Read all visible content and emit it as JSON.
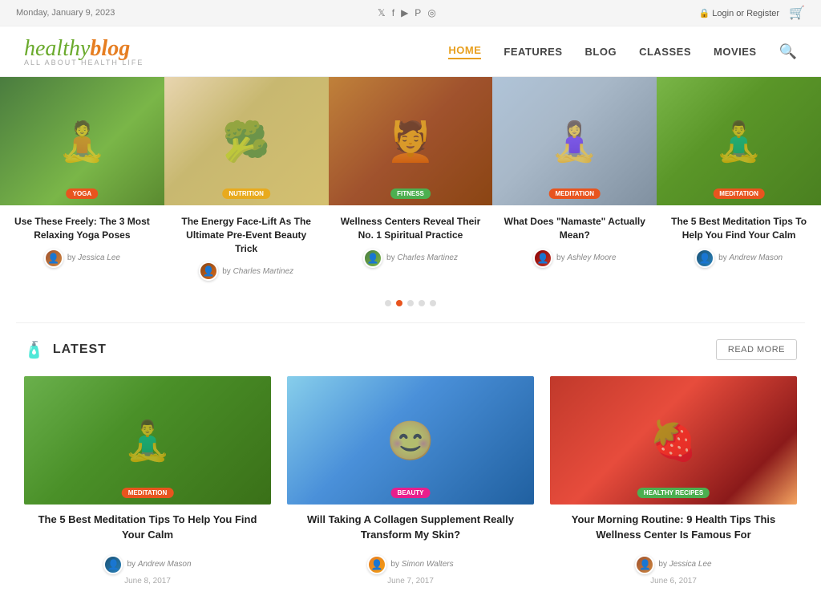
{
  "topBar": {
    "date": "Monday, January 9, 2023",
    "social": [
      "twitter",
      "facebook",
      "youtube",
      "pinterest",
      "instagram"
    ],
    "login": "Login",
    "or": "or",
    "register": "Register"
  },
  "header": {
    "logo": {
      "healthy": "healthy",
      "blog": "blog",
      "sub": "ALL ABOUT HEALTH LIFE"
    },
    "nav": [
      {
        "label": "HOME",
        "active": true
      },
      {
        "label": "FEATURES",
        "active": false
      },
      {
        "label": "BLOG",
        "active": false
      },
      {
        "label": "CLASSES",
        "active": false
      },
      {
        "label": "MOVIES",
        "active": false
      }
    ]
  },
  "carousel": {
    "items": [
      {
        "category": "YOGA",
        "categoryColor": "yoga",
        "title": "Use These Freely: The 3 Most Relaxing Yoga Poses",
        "author": "Jessica Lee",
        "avatarClass": "avatar-jessica"
      },
      {
        "category": "NUTRITION",
        "categoryColor": "nutrition",
        "title": "The Energy Face-Lift As The Ultimate Pre-Event Beauty Trick",
        "author": "Charles Martinez",
        "avatarClass": "avatar-charles"
      },
      {
        "category": "FITNESS",
        "categoryColor": "fitness",
        "title": "Wellness Centers Reveal Their No. 1 Spiritual Practice",
        "author": "Charles Martinez",
        "avatarClass": "avatar-charlesm"
      },
      {
        "category": "MEDITATION",
        "categoryColor": "meditation",
        "title": "What Does \"Namaste\" Actually Mean?",
        "author": "Ashley Moore",
        "avatarClass": "avatar-ashley"
      },
      {
        "category": "MEDITATION",
        "categoryColor": "meditation",
        "title": "The 5 Best Meditation Tips To Help You Find Your Calm",
        "author": "Andrew Mason",
        "avatarClass": "avatar-andrew"
      }
    ],
    "dots": [
      {
        "active": false
      },
      {
        "active": true
      },
      {
        "active": false
      },
      {
        "active": false
      },
      {
        "active": false
      }
    ]
  },
  "latest": {
    "title": "LATEST",
    "readMoreLabel": "READ MORE",
    "cards": [
      {
        "category": "MEDITATION",
        "title": "The 5 Best Meditation Tips To Help You Find Your Calm",
        "author": "Andrew Mason",
        "date": "June 8, 2017",
        "avatarClass": "avatar-andrew",
        "imgClass": "img-meditation-card"
      },
      {
        "category": "BEAUTY",
        "title": "Will Taking A Collagen Supplement Really Transform My Skin?",
        "author": "Simon Walters",
        "date": "June 7, 2017",
        "avatarClass": "avatar-simon",
        "imgClass": "img-collagen"
      },
      {
        "category": "HEALTHY RECIPES",
        "title": "Your Morning Routine: 9 Health Tips This Wellness Center Is Famous For",
        "author": "Jessica Lee",
        "date": "June 6, 2017",
        "avatarClass": "avatar-jessica",
        "imgClass": "img-berries"
      }
    ]
  }
}
